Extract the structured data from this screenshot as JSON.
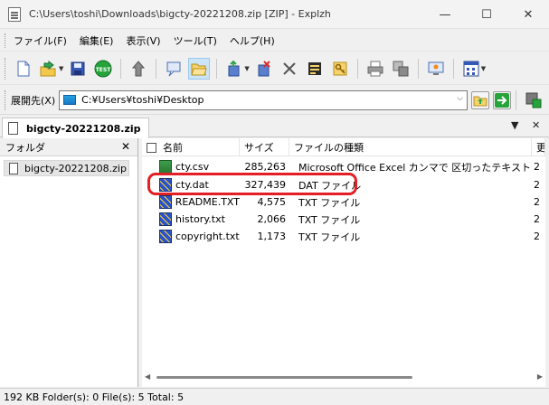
{
  "window": {
    "title": "C:\\Users\\toshi\\Downloads\\bigcty-20221208.zip [ZIP] - Explzh",
    "minimize_glyph": "—",
    "maximize_glyph": "☐",
    "close_glyph": "✕"
  },
  "menu": [
    "ファイル(F)",
    "編集(E)",
    "表示(V)",
    "ツール(T)",
    "ヘルプ(H)"
  ],
  "toolbar": {
    "buttons": [
      "new-archive-icon",
      "extract-icon",
      "save-icon",
      "test-icon",
      "up-level-icon",
      "preview-icon",
      "open-folder-icon",
      "add-files-icon",
      "delete-file-icon",
      "close-icon",
      "properties-icon",
      "key-icon",
      "print-icon",
      "copy-icon",
      "desktop-icon",
      "view-mode-icon"
    ],
    "test_label": "TEST"
  },
  "pathbar": {
    "label": "展開先(X)",
    "value": "C:¥Users¥toshi¥Desktop"
  },
  "tab": {
    "label": "bigcty-20221208.zip",
    "dropdown_glyph": "▼",
    "close_glyph": "✕"
  },
  "folder_pane": {
    "header": "フォルダ",
    "close_glyph": "✕",
    "items": [
      {
        "label": "bigcty-20221208.zip"
      }
    ]
  },
  "file_list": {
    "columns": [
      "名前",
      "サイズ",
      "ファイルの種類",
      "更"
    ],
    "rows": [
      {
        "name": "cty.csv",
        "size": "285,263",
        "type": "Microsoft Office Excel カンマで 区切ったテキストデータ",
        "extra": "2",
        "icon": "excel-csv-icon"
      },
      {
        "name": "cty.dat",
        "size": "327,439",
        "type": "DAT ファイル",
        "extra": "2",
        "icon": "dat-file-icon"
      },
      {
        "name": "README.TXT",
        "size": "4,575",
        "type": "TXT ファイル",
        "extra": "2",
        "icon": "txt-file-icon"
      },
      {
        "name": "history.txt",
        "size": "2,066",
        "type": "TXT ファイル",
        "extra": "2",
        "icon": "txt-file-icon"
      },
      {
        "name": "copyright.txt",
        "size": "1,173",
        "type": "TXT ファイル",
        "extra": "2",
        "icon": "txt-file-icon"
      }
    ]
  },
  "highlight_color": "#e31e24",
  "status": "192 KB  Folder(s): 0  File(s): 5  Total: 5"
}
